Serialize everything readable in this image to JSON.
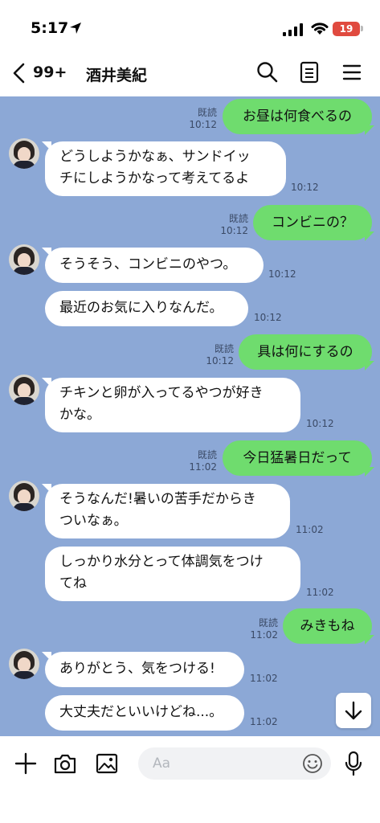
{
  "status_bar": {
    "time": "5:17",
    "battery": "19"
  },
  "header": {
    "unread_count": "99+",
    "contact_name": "酒井美紀"
  },
  "read_label": "既読",
  "messages": [
    {
      "dir": "out",
      "text": "お昼は何食べるの",
      "time": "10:12"
    },
    {
      "dir": "in",
      "lines": [
        "どうしようかなぁ、サンドイッ",
        "チにしようかなって考えてるよ"
      ],
      "time": "10:12"
    },
    {
      "dir": "out",
      "text": "コンビニの？",
      "time": "10:12"
    },
    {
      "dir": "in",
      "lines": [
        "そうそう、コンビニのやつ。"
      ],
      "time": "10:12"
    },
    {
      "dir": "in",
      "lines": [
        "最近のお気に入りなんだ。"
      ],
      "time": "10:12"
    },
    {
      "dir": "out",
      "text": "具は何にするの",
      "time": "10:12"
    },
    {
      "dir": "in",
      "lines": [
        "チキンと卵が入ってるやつが好き",
        "かな。"
      ],
      "time": "10:12"
    },
    {
      "dir": "out",
      "text": "今日猛暑日だって",
      "time": "11:02"
    },
    {
      "dir": "in",
      "lines": [
        "そうなんだ!暑いの苦手だからき",
        "ついなぁ。"
      ],
      "time": "11:02"
    },
    {
      "dir": "in",
      "lines": [
        "しっかり水分とって体調気をつけ",
        "てね"
      ],
      "time": "11:02"
    },
    {
      "dir": "out",
      "text": "みきもね",
      "time": "11:02"
    },
    {
      "dir": "in",
      "lines": [
        "ありがとう、気をつける!"
      ],
      "time": "11:02"
    },
    {
      "dir": "in",
      "lines": [
        "大丈夫だといいけどね...。"
      ],
      "time": "11:02"
    }
  ],
  "input": {
    "placeholder": "Aa"
  },
  "icons": [
    "location-arrow-icon",
    "signal-icon",
    "wifi-icon",
    "battery-icon",
    "back-chevron-icon",
    "search-icon",
    "notes-icon",
    "menu-icon",
    "scroll-down-icon",
    "plus-icon",
    "camera-icon",
    "image-icon",
    "emoji-icon",
    "microphone-icon"
  ],
  "colors": {
    "chat_bg": "#8ca8d6",
    "sent_bubble": "#6fdc6e",
    "received_bubble": "#ffffff"
  }
}
